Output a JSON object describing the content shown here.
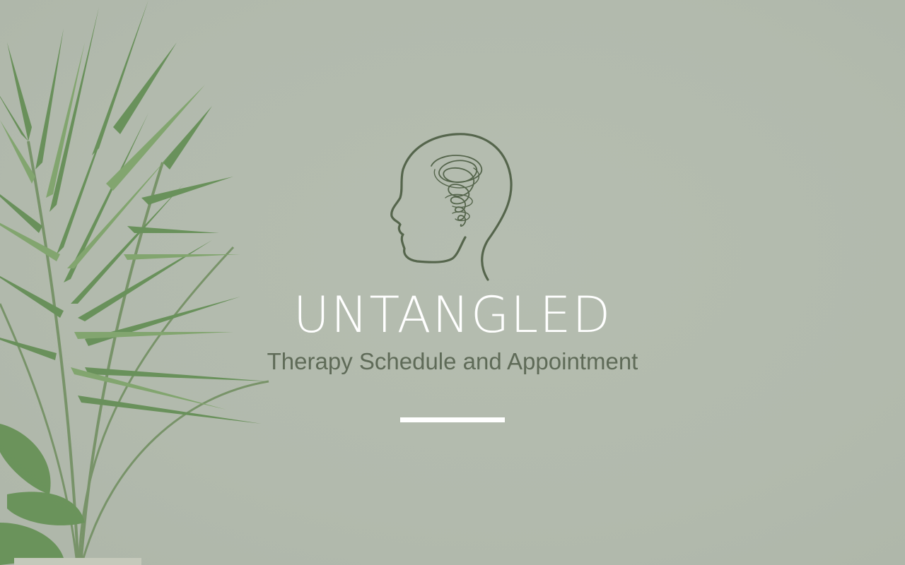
{
  "brand": {
    "title": "UNTANGLED",
    "subtitle": "Therapy Schedule and Appointment"
  },
  "icons": {
    "logo": "head-with-tangled-thoughts-icon",
    "decor": "palm-plant-illustration"
  },
  "colors": {
    "background": "#b3bbae",
    "title": "#ffffff",
    "subtitle": "#5f6b58",
    "logo_stroke": "#55654c",
    "divider": "#ffffff",
    "plant_dark": "#4f7a45",
    "plant_light": "#7fa46e"
  }
}
